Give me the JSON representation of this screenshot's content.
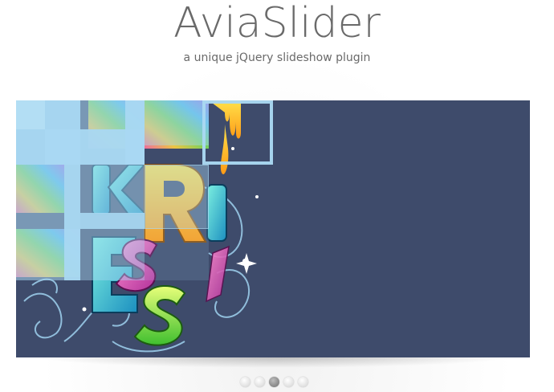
{
  "header": {
    "title": "AviaSlider",
    "subtitle": "a unique jQuery slideshow plugin"
  },
  "slider": {
    "background_color": "#3e4b6b",
    "tile_color": "#a9d8f2",
    "slide_image_icon": "colorful-3d-letters-artwork-icon",
    "slide_count": 5,
    "active_slide": 3
  },
  "pagination": {
    "dots": [
      {
        "label": "1",
        "active": false
      },
      {
        "label": "2",
        "active": false
      },
      {
        "label": "3",
        "active": true
      },
      {
        "label": "4",
        "active": false
      },
      {
        "label": "5",
        "active": false
      }
    ]
  }
}
